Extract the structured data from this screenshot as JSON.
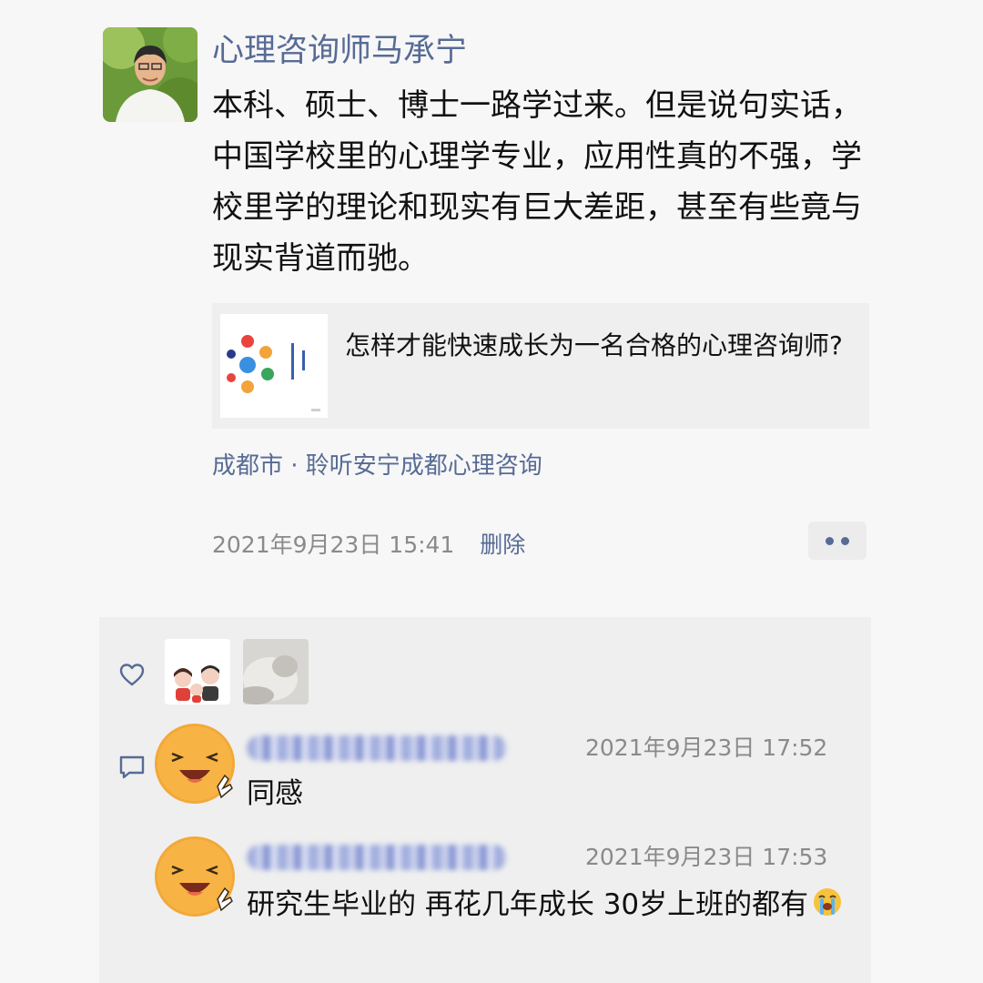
{
  "post": {
    "author": "心理咨询师马承宁",
    "body": "本科、硕士、博士一路学过来。但是说句实话，中国学校里的心理学专业，应用性真的不强，学校里学的理论和现实有巨大差距，甚至有些竟与现实背道而驰。",
    "link_title": "怎样才能快速成长为一名合格的心理咨询师?",
    "location": "成都市 · 聆听安宁成都心理咨询",
    "timestamp": "2021年9月23日 15:41",
    "delete_label": "删除"
  },
  "comments": [
    {
      "time": "2021年9月23日 17:52",
      "text": "同感"
    },
    {
      "time": "2021年9月23日 17:53",
      "text": "研究生毕业的 再花几年成长 30岁上班的都有"
    }
  ],
  "colors": {
    "link": "#576b95",
    "meta": "#8a8a8a",
    "background": "#f7f7f7",
    "panel": "#efefef"
  },
  "icons": [
    "heart-icon",
    "comment-icon",
    "more-icon",
    "crying-emoji-icon"
  ]
}
